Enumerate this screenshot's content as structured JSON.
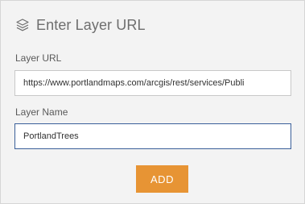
{
  "header": {
    "icon": "layers-icon",
    "title": "Enter Layer URL"
  },
  "form": {
    "url_label": "Layer URL",
    "url_value": "https://www.portlandmaps.com/arcgis/rest/services/Publi",
    "name_label": "Layer Name",
    "name_value": "PortlandTrees",
    "add_label": "ADD"
  },
  "colors": {
    "accent_button": "#e79434",
    "focus_border": "#3a5f99",
    "panel_bg": "#f3f3f3"
  }
}
